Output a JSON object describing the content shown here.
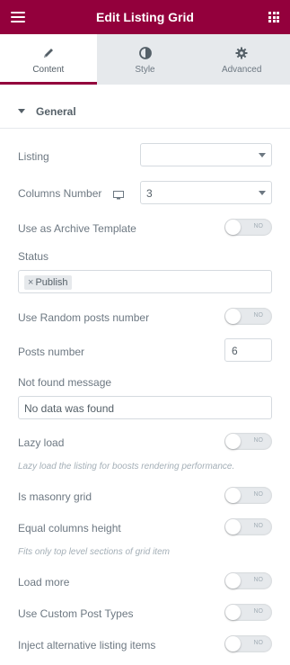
{
  "header": {
    "title": "Edit Listing Grid",
    "menu_icon": "hamburger-icon",
    "apps_icon": "grid-icon"
  },
  "tabs": [
    {
      "label": "Content",
      "icon": "pencil-icon",
      "active": true
    },
    {
      "label": "Style",
      "icon": "contrast-icon",
      "active": false
    },
    {
      "label": "Advanced",
      "icon": "gear-icon",
      "active": false
    }
  ],
  "section": {
    "title": "General",
    "icon": "caret-down-icon"
  },
  "fields": {
    "listing": {
      "label": "Listing",
      "value": ""
    },
    "columns": {
      "label": "Columns Number",
      "value": "3",
      "device_icon": "desktop-icon"
    },
    "archive": {
      "label": "Use as Archive Template",
      "toggle": "NO"
    },
    "status": {
      "label": "Status",
      "tags": [
        "Publish"
      ],
      "remove": "×"
    },
    "random": {
      "label": "Use Random posts number",
      "toggle": "NO"
    },
    "posts": {
      "label": "Posts number",
      "value": "6"
    },
    "notfound": {
      "label": "Not found message",
      "value": "No data was found"
    },
    "lazy": {
      "label": "Lazy load",
      "toggle": "NO",
      "hint": "Lazy load the listing for boosts rendering performance."
    },
    "masonry": {
      "label": "Is masonry grid",
      "toggle": "NO"
    },
    "equal": {
      "label": "Equal columns height",
      "toggle": "NO",
      "hint": "Fits only top level sections of grid item"
    },
    "loadmore": {
      "label": "Load more",
      "toggle": "NO"
    },
    "custom": {
      "label": "Use Custom Post Types",
      "toggle": "NO"
    },
    "inject": {
      "label": "Inject alternative listing items",
      "toggle": "NO"
    }
  },
  "colors": {
    "brand": "#93003c",
    "text": "#6d7882",
    "border": "#d5dadf"
  }
}
